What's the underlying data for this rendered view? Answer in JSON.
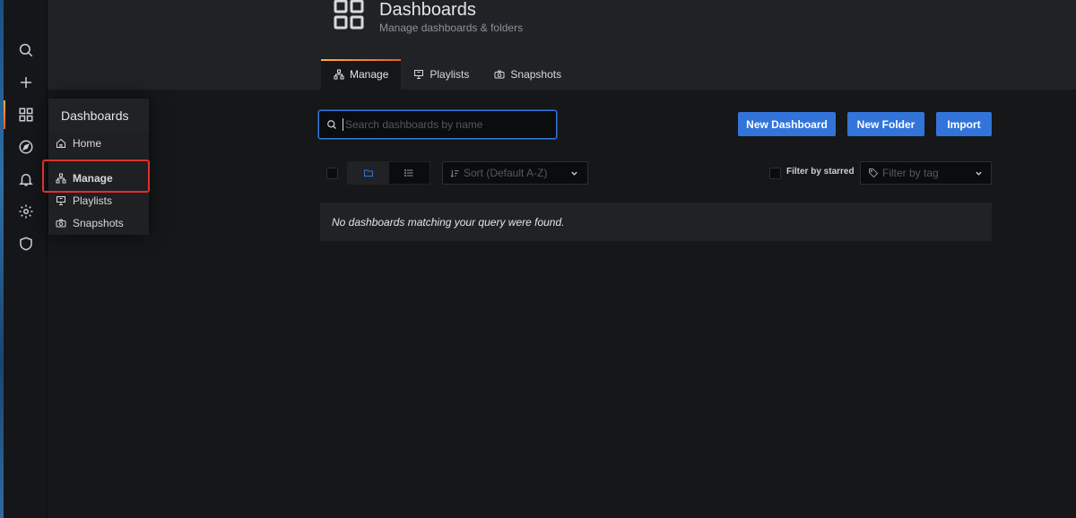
{
  "sidemenu": {
    "items": [
      {
        "name": "search",
        "icon": "search-icon"
      },
      {
        "name": "create",
        "icon": "plus-icon"
      },
      {
        "name": "dashboards",
        "icon": "apps-icon",
        "active": true
      },
      {
        "name": "explore",
        "icon": "compass-icon"
      },
      {
        "name": "alerting",
        "icon": "bell-icon"
      },
      {
        "name": "configuration",
        "icon": "gear-icon"
      },
      {
        "name": "server-admin",
        "icon": "shield-icon"
      }
    ]
  },
  "dropdown": {
    "title": "Dashboards",
    "items": [
      {
        "label": "Home",
        "icon": "home-icon"
      },
      {
        "label": "Manage",
        "icon": "sitemap-icon",
        "highlighted": true
      },
      {
        "label": "Playlists",
        "icon": "presentation-icon"
      },
      {
        "label": "Snapshots",
        "icon": "camera-icon"
      }
    ]
  },
  "header": {
    "title": "Dashboards",
    "subtitle": "Manage dashboards & folders",
    "tabs": [
      {
        "label": "Manage",
        "icon": "sitemap-icon",
        "active": true
      },
      {
        "label": "Playlists",
        "icon": "presentation-icon"
      },
      {
        "label": "Snapshots",
        "icon": "camera-icon"
      }
    ]
  },
  "toolbar": {
    "search_placeholder": "Search dashboards by name",
    "new_dashboard_label": "New Dashboard",
    "new_folder_label": "New Folder",
    "import_label": "Import"
  },
  "filters": {
    "sort_placeholder": "Sort (Default A-Z)",
    "starred_label": "Filter by starred",
    "tag_placeholder": "Filter by tag"
  },
  "results": {
    "empty_message": "No dashboards matching your query were found."
  },
  "colors": {
    "accent": "#3274d9",
    "active_gradient_start": "#ffad3a",
    "active_gradient_end": "#f05a28",
    "highlight_box": "#e02f2f"
  }
}
